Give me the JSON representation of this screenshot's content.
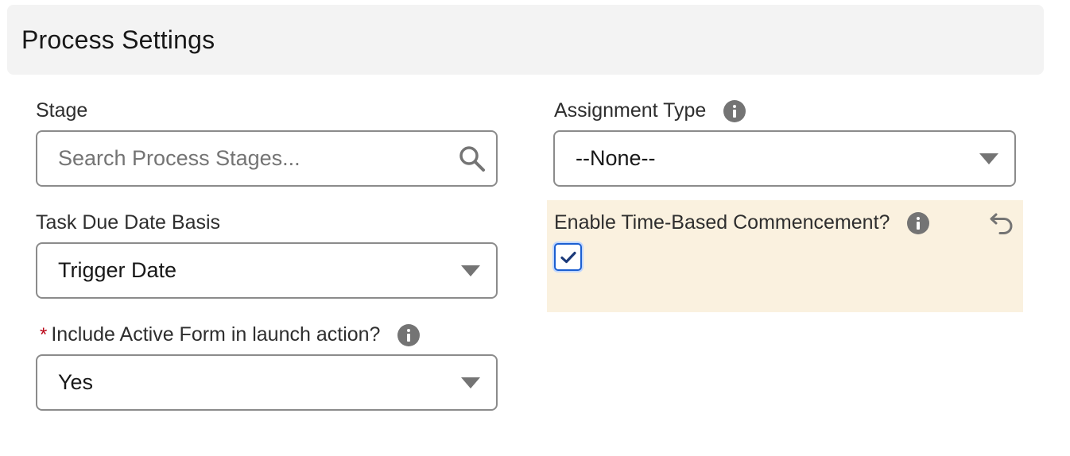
{
  "section": {
    "title": "Process Settings"
  },
  "stage": {
    "label": "Stage",
    "placeholder": "Search Process Stages...",
    "search_icon": "search-icon"
  },
  "assignment_type": {
    "label": "Assignment Type",
    "value": "--None--",
    "info_icon": "info-icon"
  },
  "task_due_date_basis": {
    "label": "Task Due Date Basis",
    "value": "Trigger Date"
  },
  "time_based_commencement": {
    "label": "Enable Time-Based Commencement?",
    "checked": true,
    "info_icon": "info-icon",
    "undo_icon": "undo-icon",
    "highlight_color": "#faf1df"
  },
  "include_active_form": {
    "required_marker": "*",
    "label": "Include Active Form in launch action?",
    "value": "Yes",
    "info_icon": "info-icon"
  },
  "colors": {
    "required": "#ba0517",
    "checkbox_accent": "#1b5fd1",
    "icon_gray": "#747474"
  }
}
